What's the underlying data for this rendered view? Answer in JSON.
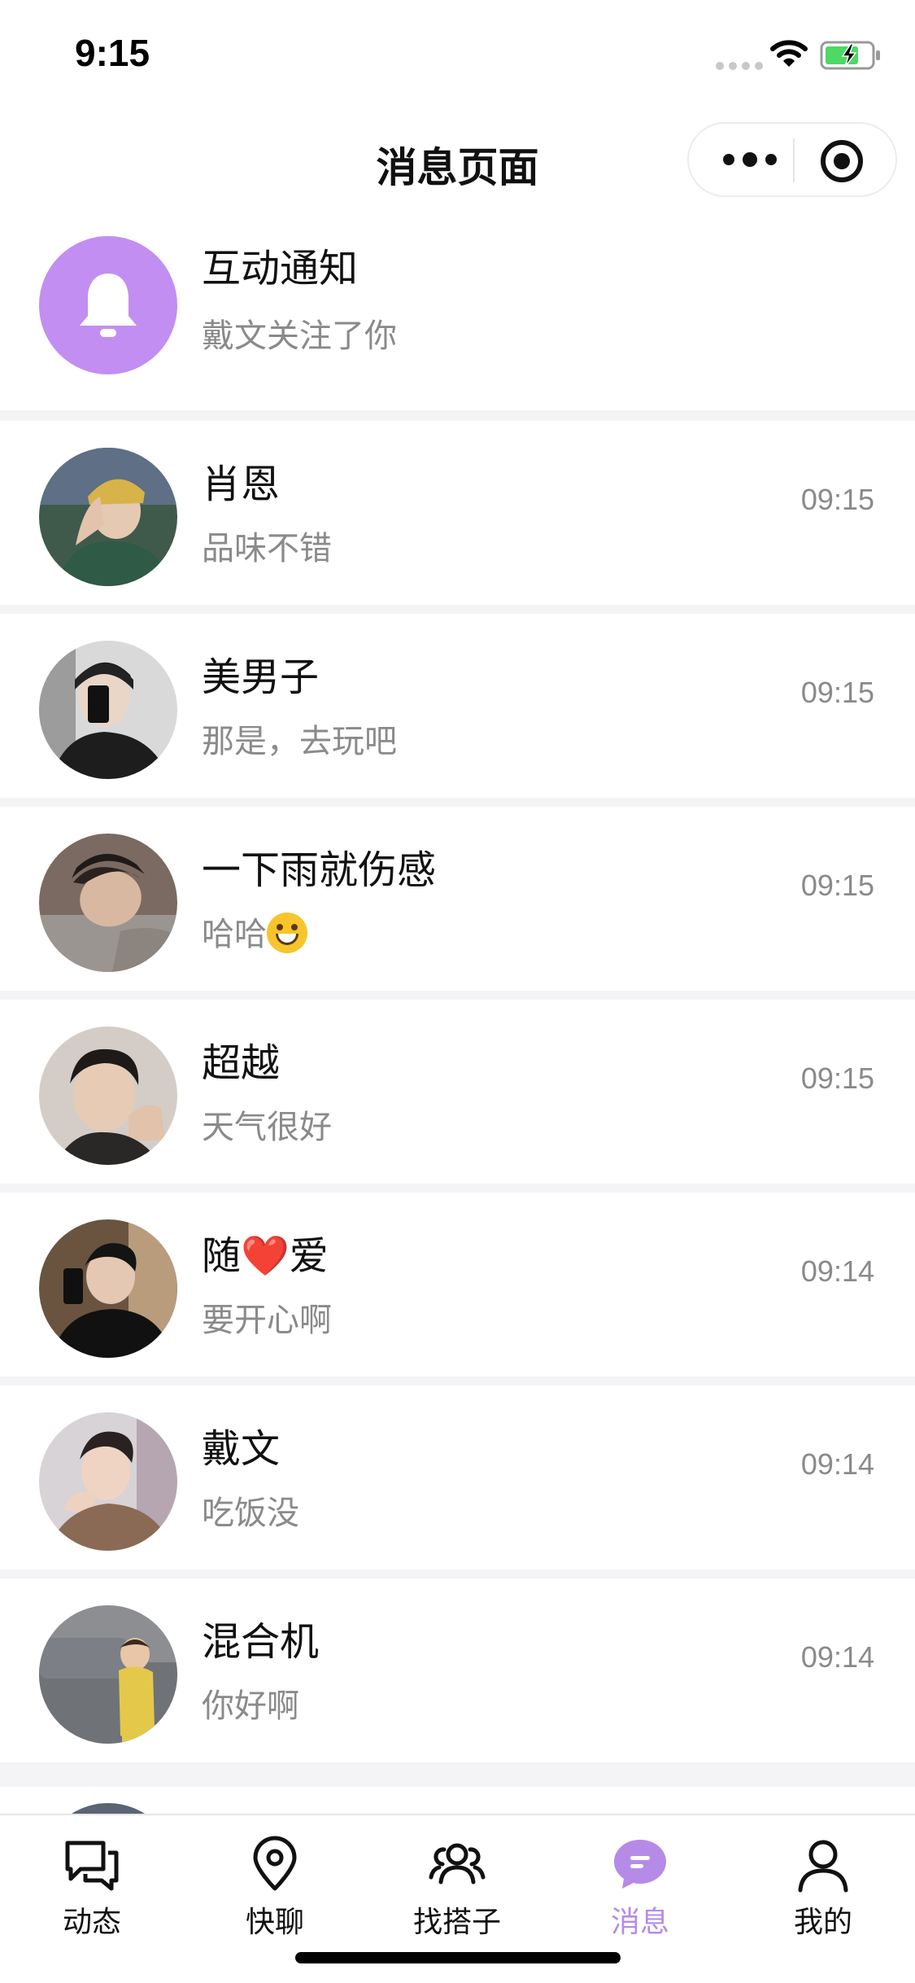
{
  "status_bar": {
    "time": "9:15"
  },
  "nav": {
    "title": "消息页面"
  },
  "notification": {
    "title": "互动通知",
    "message": "戴文关注了你",
    "icon": "bell-icon",
    "icon_bg_color": "#c28ef2"
  },
  "chats": [
    {
      "name": "肖恩",
      "message": "品味不错",
      "time": "09:15"
    },
    {
      "name": "美男子",
      "message": "那是，去玩吧",
      "time": "09:15"
    },
    {
      "name": "一下雨就伤感",
      "message": "哈哈",
      "time": "09:15"
    },
    {
      "name": "超越",
      "message": "天气很好",
      "time": "09:15"
    },
    {
      "name_prefix": "随",
      "name_heart": "❤️",
      "name_suffix": "爱",
      "message": "要开心啊",
      "time": "09:14"
    },
    {
      "name": "戴文",
      "message": "吃饭没",
      "time": "09:14"
    },
    {
      "name": "混合机",
      "message": "你好啊",
      "time": "09:14"
    }
  ],
  "tabs": [
    {
      "label": "动态",
      "icon": "chat-bubbles-icon"
    },
    {
      "label": "快聊",
      "icon": "location-pin-icon"
    },
    {
      "label": "找搭子",
      "icon": "people-icon"
    },
    {
      "label": "消息",
      "icon": "message-icon",
      "active": true
    },
    {
      "label": "我的",
      "icon": "person-icon"
    }
  ],
  "colors": {
    "accent": "#b68be8",
    "secondary_text": "#8a8a8a",
    "background": "#f4f4f6"
  }
}
